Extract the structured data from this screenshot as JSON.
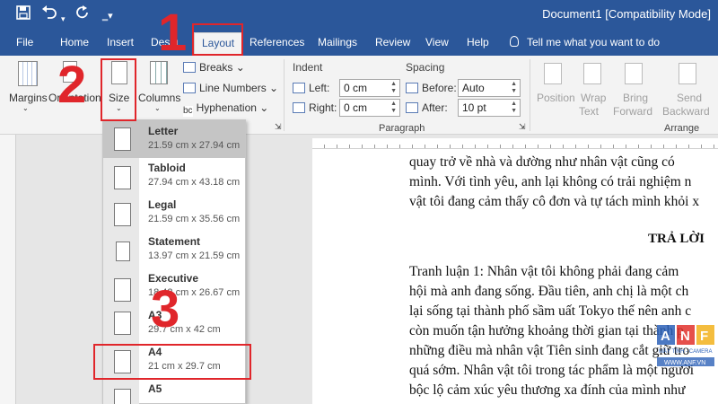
{
  "title_bar": {
    "document_title": "Document1 [Compatibility Mode]",
    "quick_access": {
      "save_icon": "save-icon",
      "undo_icon": "undo-icon",
      "redo_icon": "redo-icon",
      "customize_icon": "chevron-down-icon"
    }
  },
  "menu": {
    "tabs": [
      "File",
      "Home",
      "Insert",
      "Desig",
      "Layout",
      "References",
      "Mailings",
      "Review",
      "View",
      "Help"
    ],
    "active_tab": "Layout",
    "tell_me": "Tell me what you want to do"
  },
  "ribbon": {
    "page_setup": {
      "margins": "Margins",
      "orientation": "Orientation",
      "size": "Size",
      "columns": "Columns",
      "breaks": "Breaks",
      "line_numbers": "Line Numbers",
      "hyphenation": "Hyphenation"
    },
    "paragraph": {
      "indent_title": "Indent",
      "left_label": "Left:",
      "left_value": "0 cm",
      "right_label": "Right:",
      "right_value": "0 cm",
      "spacing_title": "Spacing",
      "before_label": "Before:",
      "before_value": "Auto",
      "after_label": "After:",
      "after_value": "10 pt",
      "group_label": "Paragraph"
    },
    "arrange": {
      "position": "Position",
      "wrap_text_1": "Wrap",
      "wrap_text_2": "Text",
      "bring_forward_1": "Bring",
      "bring_forward_2": "Forward",
      "send_backward_1": "Send",
      "send_backward_2": "Backward",
      "group_label": "Arrange"
    }
  },
  "size_menu": {
    "items": [
      {
        "name": "Letter",
        "dims": "21.59 cm x 27.94 cm"
      },
      {
        "name": "Tabloid",
        "dims": "27.94 cm x 43.18 cm"
      },
      {
        "name": "Legal",
        "dims": "21.59 cm x 35.56 cm"
      },
      {
        "name": "Statement",
        "dims": "13.97 cm x 21.59 cm"
      },
      {
        "name": "Executive",
        "dims": "18.42 cm x 26.67 cm"
      },
      {
        "name": "A3",
        "dims": "29.7 cm x 42 cm"
      },
      {
        "name": "A4",
        "dims": "21 cm x 29.7 cm"
      },
      {
        "name": "A5",
        "dims": ""
      }
    ],
    "selected": "Letter"
  },
  "annotations": {
    "step1": "1",
    "step2": "2",
    "step3": "3"
  },
  "document": {
    "lines": [
      "quay trở về nhà và dường như nhân vật cũng có",
      "mình. Với tình yêu, anh lại không có trải nghiệm n",
      "vật tôi đang cảm thấy cô đơn và tự tách mình khỏi x"
    ],
    "heading": "TRẢ LỜI",
    "lines2": [
      "Tranh luận 1: Nhân vật tôi không phải đang cảm",
      "hội mà anh đang sống.  Đầu tiên, anh chị là một ch",
      "lại sống tại thành phố sầm uất Tokyo thế nên anh c",
      "còn muốn tận hưởng khoảng thời gian tại thành p",
      "những điều mà nhân vật Tiên sinh đang cắt giữ tro",
      "quá sớm. Nhân vật tôi trong tác phẩm là một người",
      "bộc lộ cảm xúc yêu thương xa đính của mình như"
    ]
  },
  "logo": {
    "text_main": "ANF",
    "text_sub": "MÁY TÍNH - CAMERA",
    "text_url": "WWW.ANF.VN"
  },
  "colors": {
    "ribbon_blue": "#2b579a",
    "annotation_red": "#e0262b",
    "selected_gray": "#c5c5c5"
  }
}
